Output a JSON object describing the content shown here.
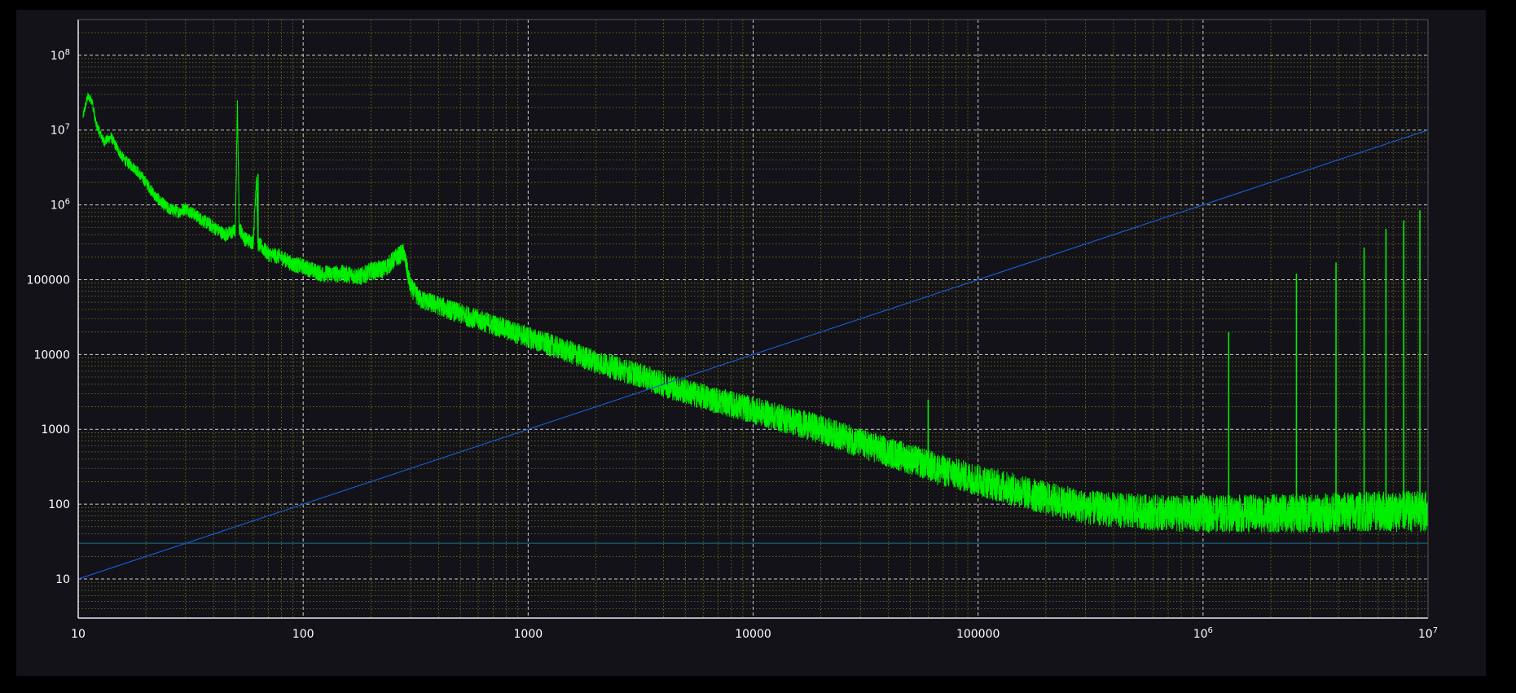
{
  "chart_data": {
    "type": "line",
    "title": "",
    "xlabel": "",
    "ylabel": "",
    "x_scale": "log",
    "y_scale": "log",
    "xlim": [
      10,
      10000000
    ],
    "ylim": [
      3,
      300000000
    ],
    "grid": true,
    "x_ticks": [
      {
        "value": 10,
        "label": "10"
      },
      {
        "value": 100,
        "label": "100"
      },
      {
        "value": 1000,
        "label": "1000"
      },
      {
        "value": 10000,
        "label": "10000"
      },
      {
        "value": 100000,
        "label": "100000"
      },
      {
        "value": 1000000,
        "label": "10⁶"
      },
      {
        "value": 10000000,
        "label": "10⁷"
      }
    ],
    "y_ticks": [
      {
        "value": 10,
        "label": "10"
      },
      {
        "value": 100,
        "label": "100"
      },
      {
        "value": 1000,
        "label": "1000"
      },
      {
        "value": 10000,
        "label": "10000"
      },
      {
        "value": 100000,
        "label": "100000"
      },
      {
        "value": 1000000,
        "label": "10⁶"
      },
      {
        "value": 10000000,
        "label": "10⁷"
      },
      {
        "value": 100000000,
        "label": "10⁸"
      }
    ],
    "series": [
      {
        "color": "#00ee00",
        "style": "noisy-spectrum",
        "x": [
          10.5,
          11,
          11.5,
          12,
          13,
          14,
          15,
          16,
          18,
          20,
          22,
          25,
          28,
          30,
          35,
          40,
          45,
          50,
          51,
          52,
          55,
          60,
          62,
          63,
          65,
          70,
          80,
          90,
          100,
          120,
          150,
          180,
          200,
          230,
          260,
          280,
          300,
          330,
          400,
          500,
          700,
          1000,
          1500,
          2000,
          2500,
          3000,
          4000,
          5000,
          7000,
          10000,
          20000,
          30000,
          50000,
          70000,
          100000,
          200000,
          300000,
          500000,
          700000,
          1000000,
          2000000,
          3000000,
          5000000,
          7000000,
          10000000
        ],
        "y": [
          15000000,
          28000000,
          25000000,
          12000000,
          7000000,
          8000000,
          5500000,
          4000000,
          3000000,
          2000000,
          1300000,
          900000,
          800000,
          900000,
          650000,
          500000,
          400000,
          450000,
          25000000,
          500000,
          350000,
          320000,
          2600000,
          300000,
          280000,
          220000,
          200000,
          160000,
          150000,
          120000,
          120000,
          110000,
          130000,
          140000,
          200000,
          230000,
          80000,
          55000,
          45000,
          35000,
          25000,
          17000,
          11000,
          8000,
          6500,
          5500,
          4000,
          3200,
          2400,
          1800,
          1000,
          650,
          400,
          280,
          210,
          120,
          90,
          80,
          75,
          75,
          75,
          75,
          80,
          80,
          80
        ],
        "spikes": [
          {
            "x": 51,
            "y": 25000000
          },
          {
            "x": 63,
            "y": 2600000
          },
          {
            "x": 60000,
            "y": 2500
          },
          {
            "x": 1300000,
            "y": 20000
          },
          {
            "x": 2600000,
            "y": 120000
          },
          {
            "x": 3900000,
            "y": 170000
          },
          {
            "x": 5200000,
            "y": 270000
          },
          {
            "x": 6500000,
            "y": 480000
          },
          {
            "x": 7800000,
            "y": 620000
          },
          {
            "x": 9200000,
            "y": 850000
          }
        ]
      },
      {
        "color": "#1f55c8",
        "style": "straight",
        "x": [
          10,
          10000000
        ],
        "y": [
          10,
          10000000
        ]
      }
    ],
    "reference_line": {
      "y": 30,
      "color": "#1f6f8b"
    }
  }
}
